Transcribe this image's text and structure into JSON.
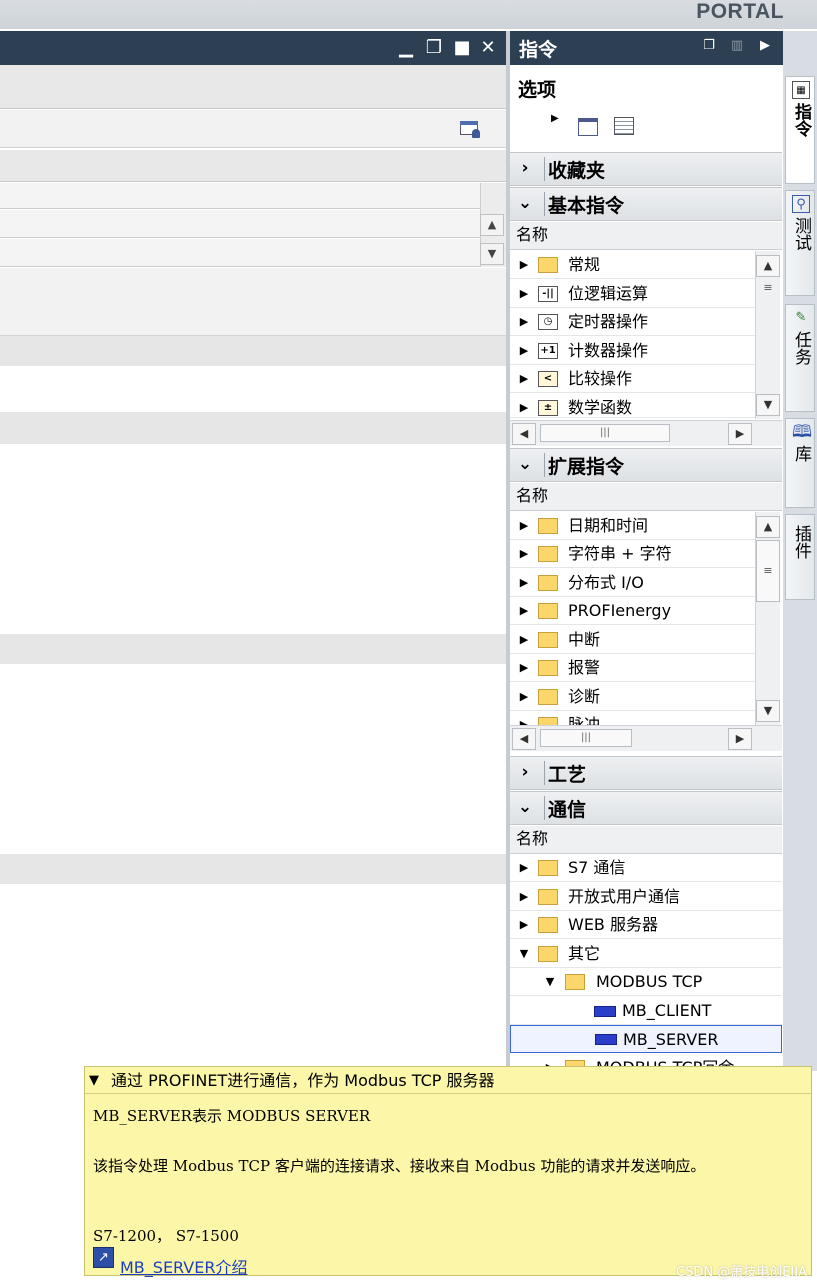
{
  "portal_label": "PORTAL",
  "editor": {
    "window_buttons": [
      "minimize-icon",
      "restore-icon",
      "maximize-icon",
      "close-icon"
    ]
  },
  "panel": {
    "title": "指令",
    "options": {
      "label": "选项"
    },
    "sections": {
      "favorites": {
        "label": "收藏夹",
        "expanded": false
      },
      "basic": {
        "label": "基本指令",
        "expanded": true,
        "column_header": "名称",
        "items": [
          {
            "label": "常规",
            "icon": "folder-icon"
          },
          {
            "label": "位逻辑运算",
            "icon": "bit-logic-icon"
          },
          {
            "label": "定时器操作",
            "icon": "timer-icon"
          },
          {
            "label": "计数器操作",
            "icon": "counter-icon"
          },
          {
            "label": "比较操作",
            "icon": "compare-icon"
          },
          {
            "label": "数学函数",
            "icon": "math-icon"
          }
        ]
      },
      "extended": {
        "label": "扩展指令",
        "expanded": true,
        "column_header": "名称",
        "items": [
          {
            "label": "日期和时间"
          },
          {
            "label": "字符串 + 字符"
          },
          {
            "label": "分布式 I/O"
          },
          {
            "label": "PROFIenergy"
          },
          {
            "label": "中断"
          },
          {
            "label": "报警"
          },
          {
            "label": "诊断"
          },
          {
            "label": "脉冲"
          }
        ]
      },
      "technology": {
        "label": "工艺",
        "expanded": false
      },
      "communication": {
        "label": "通信",
        "expanded": true,
        "column_header": "名称",
        "items": [
          {
            "label": "S7 通信"
          },
          {
            "label": "开放式用户通信"
          },
          {
            "label": "WEB 服务器"
          },
          {
            "label": "其它"
          },
          {
            "label": "MODBUS TCP"
          },
          {
            "label": "MB_CLIENT"
          },
          {
            "label": "MB_SERVER"
          },
          {
            "label": "MODBUS TCP冗余"
          }
        ]
      }
    }
  },
  "side_tabs": [
    {
      "label": "指令",
      "icon": "instructions-icon"
    },
    {
      "label": "测试",
      "icon": "test-icon"
    },
    {
      "label": "任务",
      "icon": "tasks-icon"
    },
    {
      "label": "库",
      "icon": "library-icon"
    },
    {
      "label": "插件",
      "icon": ""
    }
  ],
  "tooltip": {
    "header": "通过 PROFINET进行通信，作为 Modbus TCP 服务器",
    "line1": "MB_SERVER表示 MODBUS SERVER",
    "line2": "该指令处理 Modbus TCP 客户端的连接请求、接收来自 Modbus 功能的请求并发送响应。",
    "line3": "S7-1200， S7-1500",
    "link": "MB_SERVER介绍"
  },
  "watermark": "CSDN @萧技电创EIIA",
  "colors": {
    "titlebar": "#2d3f53",
    "tooltip_bg": "#fcf7a8",
    "folder": "#fbd66a",
    "block": "#2a3ec9",
    "selection_border": "#3a66d6"
  }
}
